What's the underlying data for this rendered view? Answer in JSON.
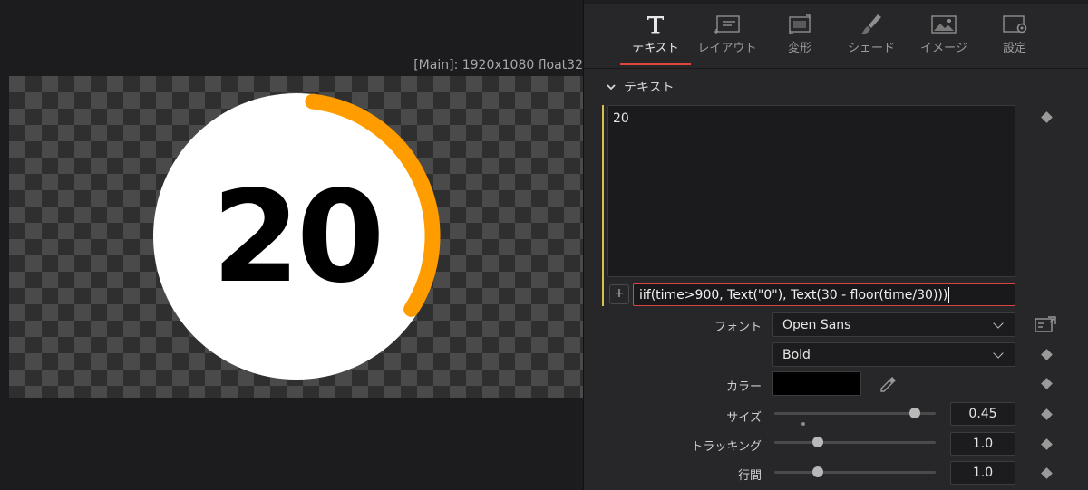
{
  "viewer": {
    "info": "[Main]: 1920x1080 float32",
    "counter_text": "20",
    "progress_fraction": 0.34,
    "colors": {
      "ring": "#ff9d00",
      "circle": "#ffffff",
      "text": "#000000"
    }
  },
  "tabs": [
    {
      "label": "テキスト",
      "icon": "text-icon",
      "active": true
    },
    {
      "label": "レイアウト",
      "icon": "layout-icon",
      "active": false
    },
    {
      "label": "変形",
      "icon": "transform-icon",
      "active": false
    },
    {
      "label": "シェード",
      "icon": "shade-brush-icon",
      "active": false
    },
    {
      "label": "イメージ",
      "icon": "image-icon",
      "active": false
    },
    {
      "label": "設定",
      "icon": "settings-icon",
      "active": false
    }
  ],
  "section": {
    "title": "テキスト"
  },
  "text_input": {
    "value": "20"
  },
  "expression": {
    "plus": "+",
    "value": "iif(time>900, Text(\"0\"), Text(30 - floor(time/30)))"
  },
  "font": {
    "label": "フォント",
    "family": "Open Sans",
    "style": "Bold"
  },
  "color": {
    "label": "カラー",
    "value": "#000000"
  },
  "size": {
    "label": "サイズ",
    "value": "0.45",
    "slider_fraction": 0.87
  },
  "tracking": {
    "label": "トラッキング",
    "value": "1.0",
    "slider_fraction": 0.27
  },
  "line_spacing": {
    "label": "行間",
    "value": "1.0",
    "slider_fraction": 0.27
  },
  "accent_color": "#e0463e"
}
